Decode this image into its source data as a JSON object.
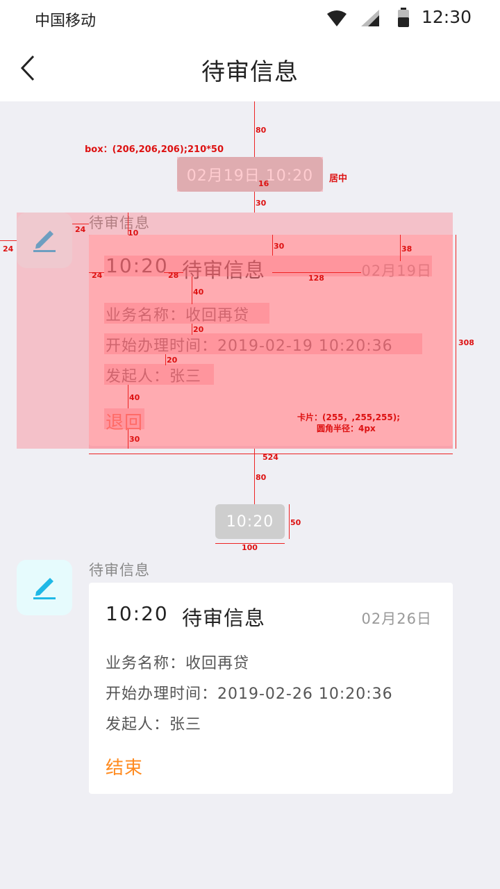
{
  "status_bar": {
    "carrier": "中国移动",
    "time": "12:30"
  },
  "nav": {
    "title": "待审信息"
  },
  "messages": [
    {
      "time_pill": "02月19日 10:20",
      "sender": "待审信息",
      "card": {
        "time": "10:20",
        "title": "待审信息",
        "date": "02月19日",
        "business_label": "业务名称：收回再贷",
        "start_label": "开始办理时间：2019-02-19 10:20:36",
        "initiator_label": "发起人：张三",
        "action": "退回",
        "action_color": "#ff6a3c"
      }
    },
    {
      "time_pill": "10:20",
      "sender": "待审信息",
      "card": {
        "time": "10:20",
        "title": "待审信息",
        "date": "02月26日",
        "business_label": "业务名称：收回再贷",
        "start_label": "开始办理时间：2019-02-26 10:20:36",
        "initiator_label": "发起人：张三",
        "action": "结束",
        "action_color": "#ff8a1e"
      }
    }
  ],
  "annotations": {
    "box_spec": "box：(206,206,206);210*50",
    "center": "居中",
    "card_spec_1": "卡片：(255，,255,255);",
    "card_spec_2": "圆角半径：4px",
    "n80": "80",
    "n16": "16",
    "n30": "30",
    "n24": "24",
    "n10": "10",
    "n38": "38",
    "n28": "28",
    "n128": "128",
    "n40": "40",
    "n20": "20",
    "n308": "308",
    "n524": "524",
    "n50": "50",
    "n100": "100"
  },
  "colors": {
    "background": "#efeff4",
    "pill": "#cecece",
    "avatar_bg": "#e6fbfd",
    "icon": "#1fb8e6"
  }
}
